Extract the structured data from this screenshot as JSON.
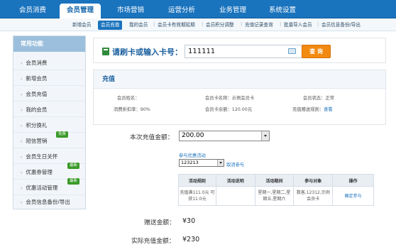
{
  "top_nav": [
    "会员消费",
    "会员管理",
    "市场营销",
    "运营分析",
    "业务管理",
    "系统设置"
  ],
  "sub_nav": [
    "新增会员",
    "会员充值",
    "我的会员",
    "会员卡有效期延期",
    "会员积分调整",
    "充值记录查询",
    "批量导入会员",
    "会员信息备份/导出"
  ],
  "sidebar": {
    "title": "常用功能",
    "items": [
      {
        "label": "会员消费"
      },
      {
        "label": "新增会员"
      },
      {
        "label": "会员充值"
      },
      {
        "label": "我的会员"
      },
      {
        "label": "积分换礼"
      },
      {
        "label": "短信营销",
        "badge": "免费"
      },
      {
        "label": "会员生日关怀"
      },
      {
        "label": "优惠券管理",
        "badge": "最新"
      },
      {
        "label": "优惠活动管理",
        "badge": "最新"
      },
      {
        "label": "会员信息备份/导出"
      }
    ]
  },
  "search": {
    "label": "请刷卡或输入卡号：",
    "value": "111111",
    "button": "查 询"
  },
  "recharge_panel": {
    "title": "充值",
    "member_name": "会员姓名：",
    "card_name": "会员卡名称：示例会员卡",
    "status": "会员状态：正常",
    "discount": "消费折扣率：90%",
    "balance": "会员卡余额：120.00元",
    "gift_rule_label": "充值赠送规则：",
    "gift_rule_link": "查看"
  },
  "form": {
    "amount_label": "本次充值金额：",
    "amount_value": "200.00",
    "promo_link": "参与优惠活动",
    "promo_select": "123213",
    "cancel_link": "取消参与",
    "table": {
      "headers": [
        "活动规则",
        "活动说明",
        "活动期间",
        "参与对象",
        "操作"
      ],
      "rows": [
        [
          "充值满111.0元 可获11.0元",
          "",
          "星期一,星期二,星期五,星期六",
          "数客,12312,示例会员卡",
          "确定参与"
        ]
      ]
    },
    "gift_label": "赠送金额：",
    "gift_value": "¥30",
    "actual_label": "实际充值金额：",
    "actual_value": "¥230"
  },
  "colors": {
    "nav_blue": "#1a73bd",
    "query_orange": "#f28a11",
    "badge_green": "#3a9a28"
  }
}
